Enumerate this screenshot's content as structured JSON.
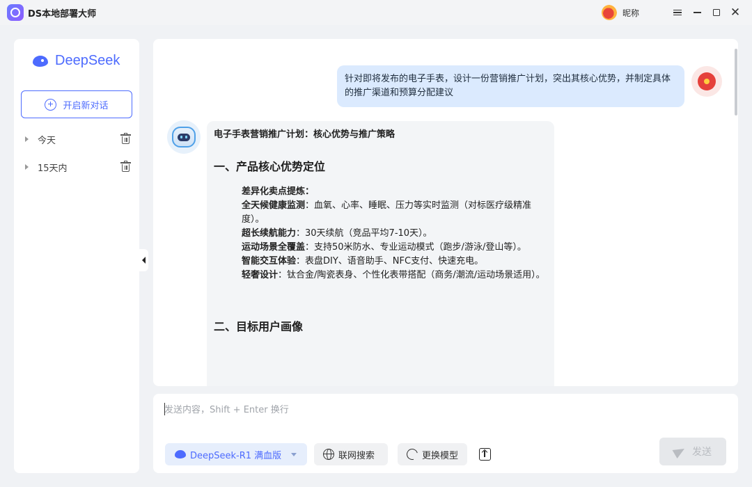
{
  "window": {
    "title": "DS本地部署大师",
    "nickname": "昵称"
  },
  "sidebar": {
    "logo_text": "DeepSeek",
    "new_chat_label": "开启新对话",
    "history": [
      {
        "label": "今天"
      },
      {
        "label": "15天内"
      }
    ]
  },
  "chat": {
    "user_message": "针对即将发布的电子手表，设计一份营销推广计划，突出其核心优势，并制定具体的推广渠道和预算分配建议",
    "bot": {
      "title": "电子手表营销推广计划：核心优势与推广策略",
      "section1": "一、产品核心优势定位",
      "intro": "差异化卖点提炼：",
      "items": [
        {
          "bold": "全天候健康监测",
          "text": "：血氧、心率、睡眠、压力等实时监测（对标医疗级精准度）。"
        },
        {
          "bold": "超长续航能力",
          "text": "：30天续航（竞品平均7-10天）。"
        },
        {
          "bold": "运动场景全覆盖",
          "text": "：支持50米防水、专业运动模式（跑步/游泳/登山等）。"
        },
        {
          "bold": "智能交互体验",
          "text": "：表盘DIY、语音助手、NFC支付、快速充电。"
        },
        {
          "bold": "轻奢设计",
          "text": "：钛合金/陶瓷表身、个性化表带搭配（商务/潮流/运动场景适用）。"
        }
      ],
      "section2": "二、目标用户画像"
    }
  },
  "input": {
    "placeholder": "发送内容，Shift + Enter 换行",
    "model_label": "DeepSeek-R1 满血版",
    "web_search_label": "联网搜索",
    "switch_model_label": "更换模型",
    "send_label": "发送"
  },
  "colors": {
    "accent": "#4d6bfe",
    "user_bubble": "#dbeafe",
    "bot_card": "#f3f5f7"
  }
}
